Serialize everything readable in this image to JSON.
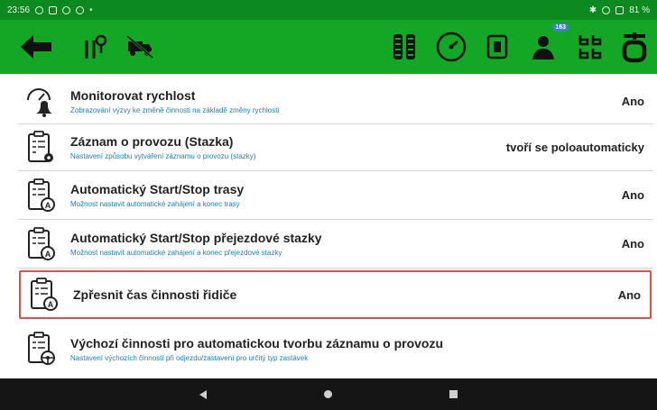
{
  "status": {
    "time": "23:56",
    "battery": "81 %"
  },
  "toolbar": {
    "notification_count": "163"
  },
  "settings": [
    {
      "title": "Monitorovat rychlost",
      "subtitle": "Zobrazování výzvy ke změně činnosti na základě změny rychlosti",
      "value": "Ano",
      "icon": "speedometer-bell-icon"
    },
    {
      "title": "Záznam o provozu (Stazka)",
      "subtitle": "Nastavení způsobu vytváření záznamu o provozu (stazky)",
      "value": "tvoří se poloautomaticky",
      "icon": "clipboard-gear-icon"
    },
    {
      "title": "Automatický Start/Stop trasy",
      "subtitle": "Možnost nastavit automatické zahájení a konec trasy",
      "value": "Ano",
      "icon": "clipboard-auto-icon"
    },
    {
      "title": "Automatický Start/Stop přejezdové stazky",
      "subtitle": "Možnost nastavit automatické zahájení a konec přejezdové stazky",
      "value": "Ano",
      "icon": "clipboard-auto-icon"
    },
    {
      "title": "Zpřesnit čas činnosti řidiče",
      "subtitle": "",
      "value": "Ano",
      "icon": "clipboard-auto-icon"
    },
    {
      "title": "Výchozí činnosti pro automatickou tvorbu záznamu o provozu",
      "subtitle": "Nastavení výchozích činností při odjezdu/zastavení pro určitý typ zastávek",
      "value": "",
      "icon": "clipboard-steering-icon"
    }
  ],
  "colors": {
    "toolbar": "#14a625",
    "statusbar": "#0d8a1f",
    "subtitle": "#1a7fb5",
    "highlight_border": "#e05050"
  }
}
